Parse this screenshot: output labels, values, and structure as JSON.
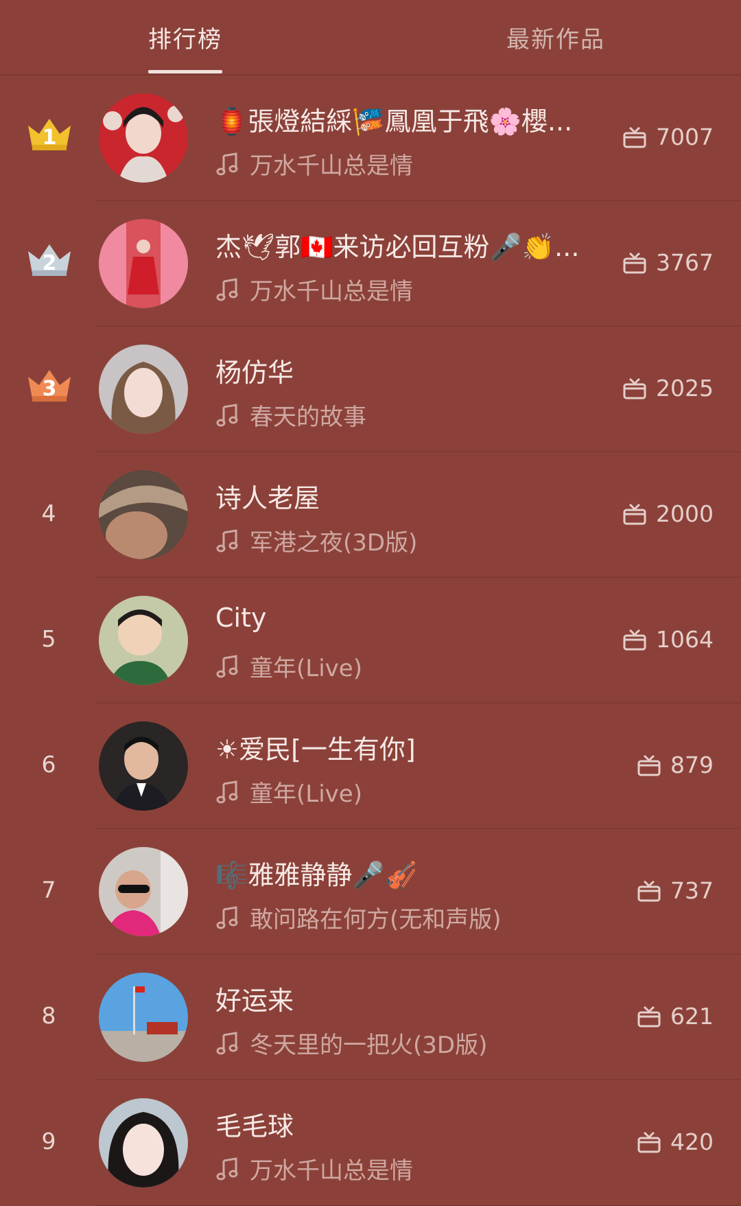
{
  "tabs": {
    "ranking": "排行榜",
    "latest": "最新作品"
  },
  "entries": [
    {
      "rank": "1",
      "name": "🏮張燈結綵🎏鳳凰于飛🌸櫻...",
      "song": "万水千山总是情",
      "gifts": "7007",
      "crown": "gold"
    },
    {
      "rank": "2",
      "name": "杰🕊郭🇨🇦来访必回互粉🎤👏...",
      "song": "万水千山总是情",
      "gifts": "3767",
      "crown": "silver"
    },
    {
      "rank": "3",
      "name": "杨仿华",
      "song": "春天的故事",
      "gifts": "2025",
      "crown": "bronze"
    },
    {
      "rank": "4",
      "name": "诗人老屋",
      "song": "军港之夜(3D版)",
      "gifts": "2000"
    },
    {
      "rank": "5",
      "name": "City",
      "song": "童年(Live)",
      "gifts": "1064"
    },
    {
      "rank": "6",
      "name": "☀爱民[一生有你]",
      "song": "童年(Live)",
      "gifts": "879"
    },
    {
      "rank": "7",
      "name": "🎼雅雅静静🎤🎻",
      "song": "敢问路在何方(无和声版)",
      "gifts": "737"
    },
    {
      "rank": "8",
      "name": "好运来",
      "song": "冬天里的一把火(3D版)",
      "gifts": "621"
    },
    {
      "rank": "9",
      "name": "毛毛球",
      "song": "万水千山总是情",
      "gifts": "420"
    }
  ],
  "colors": {
    "background": "#8b4139",
    "gold": "#f2c12e",
    "silver": "#c9d3dc",
    "bronze": "#f08a55"
  },
  "icons": {
    "song": "music-note-icon",
    "gift": "gift-icon",
    "crown": "crown-icon"
  }
}
